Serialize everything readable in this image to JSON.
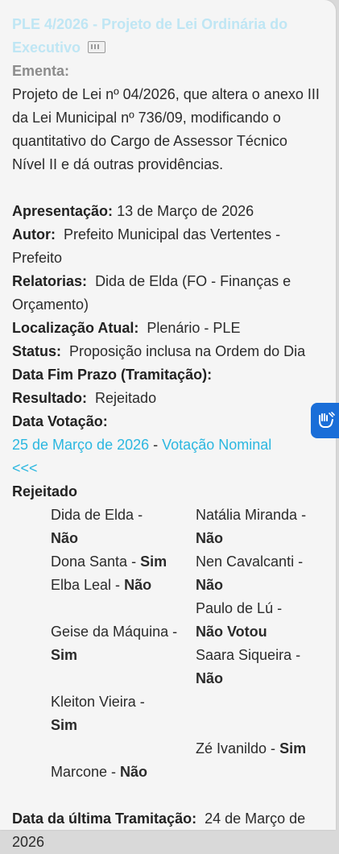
{
  "title": "PLE 4/2026 - Projeto de Lei Ordinária do Executivo",
  "ementa": {
    "label": "Ementa:",
    "text": "Projeto de Lei nº 04/2026, que altera o anexo III da Lei Municipal nº 736/09, modificando o quantitativo do Cargo de Assessor Técnico Nível II e dá outras providências."
  },
  "fields": {
    "apresentacao": {
      "label": "Apresentação:",
      "value": "13 de Março de 2026"
    },
    "autor": {
      "label": "Autor:",
      "value": "Prefeito Municipal das Vertentes - Prefeito"
    },
    "relatorias": {
      "label": "Relatorias:",
      "value": "Dida de Elda (FO - Finanças e Orçamento)"
    },
    "localizacao": {
      "label": "Localização Atual:",
      "value": "Plenário - PLE"
    },
    "status": {
      "label": "Status:",
      "value": "Proposição inclusa na Ordem do Dia"
    },
    "data_fim_prazo": {
      "label": "Data Fim Prazo (Tramitação):",
      "value": ""
    },
    "resultado": {
      "label": "Resultado:",
      "value": "Rejeitado"
    },
    "data_votacao": {
      "label": "Data Votação:"
    }
  },
  "votacao": {
    "date_link": "25 de Março de 2026",
    "separator": "-",
    "nominal_link": "Votação Nominal",
    "back_link": "<<<",
    "result": "Rejeitado",
    "votes": [
      {
        "name": "Dida de Elda -",
        "vote": "Não"
      },
      {
        "name": "Natália Miranda -",
        "vote": "Não"
      },
      {
        "name": "Dona Santa -",
        "vote": "Sim"
      },
      {
        "name": "Nen Cavalcanti -",
        "vote": "Não"
      },
      {
        "name": "Elba Leal -",
        "vote": "Não"
      },
      {
        "name": "Paulo de Lú -",
        "vote": "Não Votou"
      },
      {
        "name": "Geise da Máquina -",
        "vote": "Sim"
      },
      {
        "name": "Saara Siqueira -",
        "vote": "Não"
      },
      {
        "name": "Kleiton Vieira -",
        "vote": "Sim"
      },
      {
        "name": "Zé Ivanildo -",
        "vote": "Sim"
      },
      {
        "name": "Marcone -",
        "vote": "Não"
      }
    ]
  },
  "ultima_tramitacao": {
    "label": "Data da última Tramitação:",
    "value": "24 de Março de 2026"
  },
  "colors": {
    "link": "#2bb7e0",
    "title": "#bfe6f4",
    "accessibility_button": "#1a6ed8"
  },
  "icons": {
    "title_doc": "document-icon",
    "accessibility": "hand-sign-language-icon"
  }
}
